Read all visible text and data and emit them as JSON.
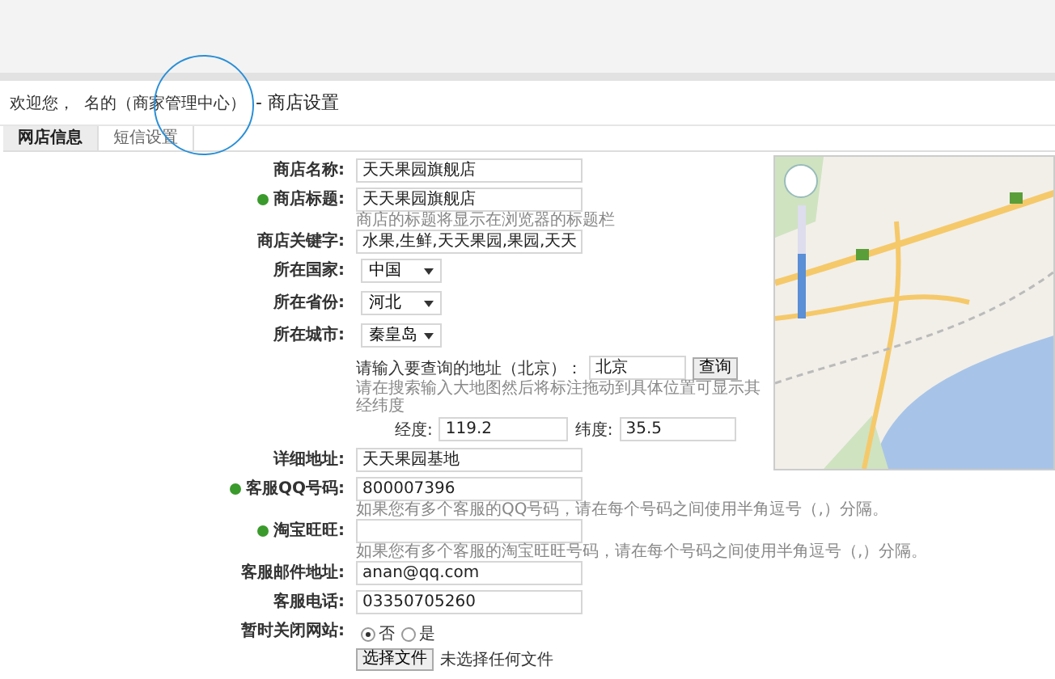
{
  "breadcrumb": {
    "greeting": "欢迎您，",
    "section": "名的（商家管理中心）",
    "current": "- 商店设置"
  },
  "tabs": [
    {
      "label": "网店信息",
      "selected": true
    },
    {
      "label": "短信设置",
      "selected": false
    }
  ],
  "form": [
    {
      "kind": "text",
      "label": "商店名称:",
      "marked": false,
      "value": "天天果园旗舰店"
    },
    {
      "kind": "text",
      "label": "商店标题:",
      "marked": true,
      "value": "天天果园旗舰店",
      "hint": "商店的标题将显示在浏览器的标题栏"
    },
    {
      "kind": "text",
      "label": "商店关键字:",
      "marked": false,
      "value": "水果,生鲜,天天果园,果园,天天"
    },
    {
      "kind": "select",
      "label": "所在国家:",
      "marked": false,
      "value": "中国"
    },
    {
      "kind": "select",
      "label": "所在省份:",
      "marked": false,
      "value": "河北"
    },
    {
      "kind": "select",
      "label": "所在城市:",
      "marked": false,
      "value": "秦皇岛"
    },
    {
      "kind": "query",
      "prompt": "请输入要查询的地址（北京）：",
      "value": "北京",
      "button": "查询",
      "hint": "请在搜索输入大地图然后将标注拖动到具体位置可显示其经纬度"
    },
    {
      "kind": "coords",
      "lng_label": "经度:",
      "lng": "119.2",
      "lat_label": "纬度:",
      "lat": "35.5"
    },
    {
      "kind": "text",
      "label": "详细地址:",
      "marked": false,
      "value": "天天果园基地"
    },
    {
      "kind": "text",
      "label": "客服QQ号码:",
      "marked": true,
      "value": "800007396",
      "hint": "如果您有多个客服的QQ号码，请在每个号码之间使用半角逗号（,）分隔。"
    },
    {
      "kind": "text",
      "label": "淘宝旺旺:",
      "marked": true,
      "hint": "如果您有多个客服的淘宝旺旺号码，请在每个号码之间使用半角逗号（,）分隔。"
    },
    {
      "kind": "text",
      "label": "客服邮件地址:",
      "marked": false,
      "value": "anan@qq.com"
    },
    {
      "kind": "text",
      "label": "客服电话:",
      "marked": false,
      "value": "03350705260"
    },
    {
      "kind": "radio",
      "label": "暂时关闭网站:",
      "marked": false,
      "options": [
        {
          "label": "否",
          "selected": true
        },
        {
          "label": "是",
          "selected": false
        }
      ]
    },
    {
      "kind": "file",
      "button": "选择文件",
      "status": "未选择任何文件"
    }
  ]
}
